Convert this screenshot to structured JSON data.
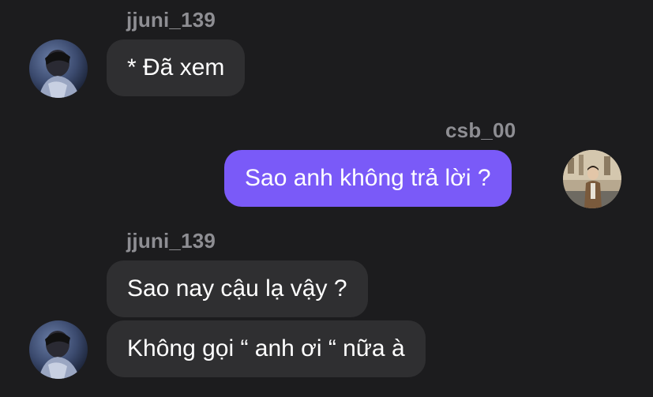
{
  "messages": [
    {
      "sender": "jjuni_139",
      "text": "* Đã xem"
    },
    {
      "sender": "csb_00",
      "text": "Sao anh không trả lời ?"
    },
    {
      "sender": "jjuni_139",
      "text": "Sao nay cậu lạ vậy ?"
    },
    {
      "text": "Không gọi “ anh ơi “ nữa à"
    }
  ],
  "colors": {
    "background": "#1c1c1e",
    "incoming_bubble": "#2f2f31",
    "outgoing_bubble": "#7a5af8",
    "username": "#8e8e93",
    "text": "#ffffff"
  },
  "icons": {
    "contact_avatar": "avatar-jjuni-photo",
    "self_avatar": "avatar-csb-photo"
  }
}
